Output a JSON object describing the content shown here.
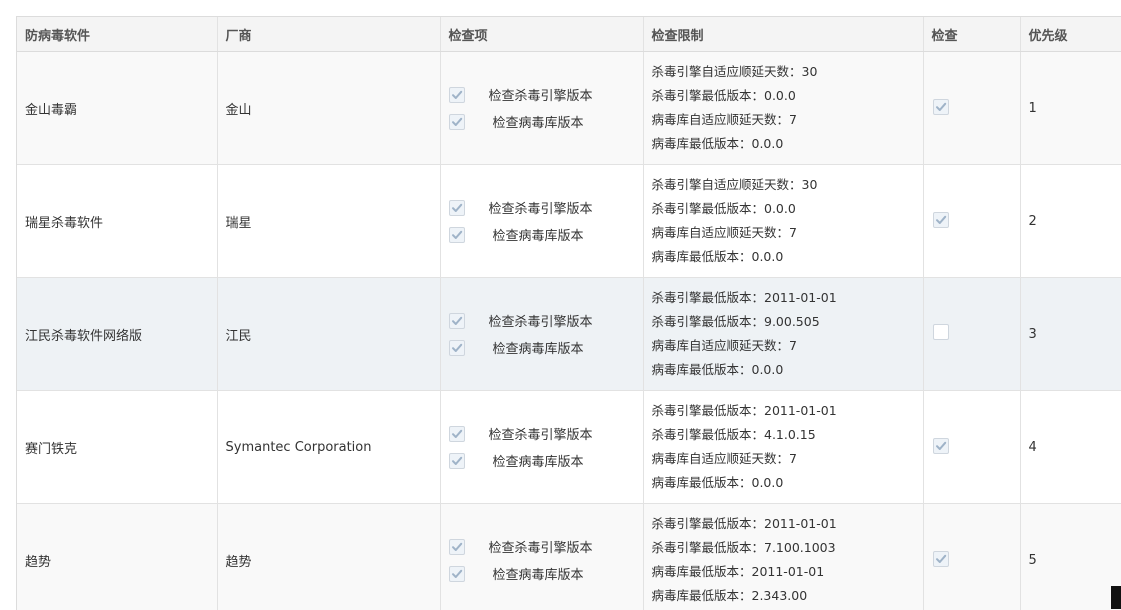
{
  "table": {
    "headers": [
      "防病毒软件",
      "厂商",
      "检查项",
      "检查限制",
      "检查",
      "优先级"
    ],
    "rows": [
      {
        "software": "金山毒霸",
        "vendor": "金山",
        "check_items": [
          {
            "label": "检查杀毒引擎版本",
            "checked": true
          },
          {
            "label": "检查病毒库版本",
            "checked": true
          }
        ],
        "limits": [
          "杀毒引擎自适应顺延天数：30",
          "杀毒引擎最低版本：0.0.0",
          "病毒库自适应顺延天数：7",
          "病毒库最低版本：0.0.0"
        ],
        "inspect": true,
        "priority": "1"
      },
      {
        "software": "瑞星杀毒软件",
        "vendor": "瑞星",
        "check_items": [
          {
            "label": "检查杀毒引擎版本",
            "checked": true
          },
          {
            "label": "检查病毒库版本",
            "checked": true
          }
        ],
        "limits": [
          "杀毒引擎自适应顺延天数：30",
          "杀毒引擎最低版本：0.0.0",
          "病毒库自适应顺延天数：7",
          "病毒库最低版本：0.0.0"
        ],
        "inspect": true,
        "priority": "2"
      },
      {
        "software": "江民杀毒软件网络版",
        "vendor": "江民",
        "check_items": [
          {
            "label": "检查杀毒引擎版本",
            "checked": true
          },
          {
            "label": "检查病毒库版本",
            "checked": true
          }
        ],
        "limits": [
          "杀毒引擎最低版本：2011-01-01",
          "杀毒引擎最低版本：9.00.505",
          "病毒库自适应顺延天数：7",
          "病毒库最低版本：0.0.0"
        ],
        "inspect": false,
        "priority": "3"
      },
      {
        "software": "赛门铁克",
        "vendor": "Symantec Corporation",
        "check_items": [
          {
            "label": "检查杀毒引擎版本",
            "checked": true
          },
          {
            "label": "检查病毒库版本",
            "checked": true
          }
        ],
        "limits": [
          "杀毒引擎最低版本：2011-01-01",
          "杀毒引擎最低版本：4.1.0.15",
          "病毒库自适应顺延天数：7",
          "病毒库最低版本：0.0.0"
        ],
        "inspect": true,
        "priority": "4"
      },
      {
        "software": "趋势",
        "vendor": "趋势",
        "check_items": [
          {
            "label": "检查杀毒引擎版本",
            "checked": true
          },
          {
            "label": "检查病毒库版本",
            "checked": true
          }
        ],
        "limits": [
          "杀毒引擎最低版本：2011-01-01",
          "杀毒引擎最低版本：7.100.1003",
          "病毒库最低版本：2011-01-01",
          "病毒库最低版本：2.343.00"
        ],
        "inspect": true,
        "priority": "5"
      }
    ]
  },
  "colors": {
    "checkmark": "#9fb3c8",
    "header_bg": "#f4f4f4",
    "highlight_row_bg": "#eef2f5"
  },
  "icons": {
    "checkbox_checked": "checkmark-icon"
  }
}
